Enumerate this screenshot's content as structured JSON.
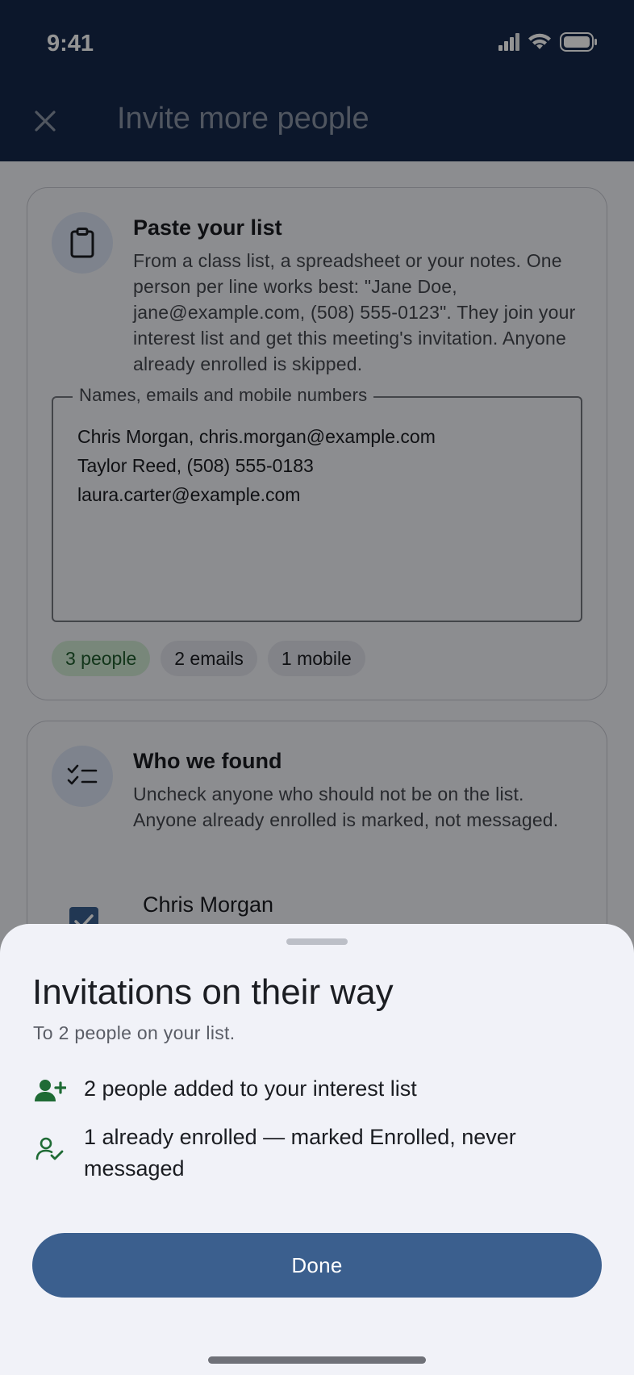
{
  "status_bar": {
    "time": "9:41"
  },
  "app_bar": {
    "title": "Invite more people",
    "close_icon": "close-icon"
  },
  "paste_card": {
    "title": "Paste your list",
    "description": "From a class list, a spreadsheet or your notes. One person per line works best: \"Jane Doe, jane@example.com, (508) 555-0123\". They join your interest list and get this meeting's invitation. Anyone already enrolled is skipped.",
    "textarea_label": "Names, emails and mobile numbers",
    "lines": [
      "Chris Morgan, chris.morgan@example.com",
      "Taylor Reed, (508) 555-0183",
      "laura.carter@example.com"
    ],
    "chips": [
      "3 people",
      "2 emails",
      "1 mobile"
    ]
  },
  "found_card": {
    "title": "Who we found",
    "description": "Uncheck anyone who should not be on the list. Anyone already enrolled is marked, not messaged.",
    "first_person": "Chris Morgan"
  },
  "sheet": {
    "title": "Invitations on their way",
    "subtitle": "To 2 people on your list.",
    "items": [
      {
        "icon": "person-add-icon",
        "text": "2 people added to your interest list"
      },
      {
        "icon": "person-check-icon",
        "text": "1 already enrolled — marked Enrolled, never messaged"
      }
    ],
    "done_label": "Done"
  },
  "colors": {
    "header": "#16294a",
    "primary_button": "#3b5f8e",
    "success_green": "#1f6b35"
  }
}
